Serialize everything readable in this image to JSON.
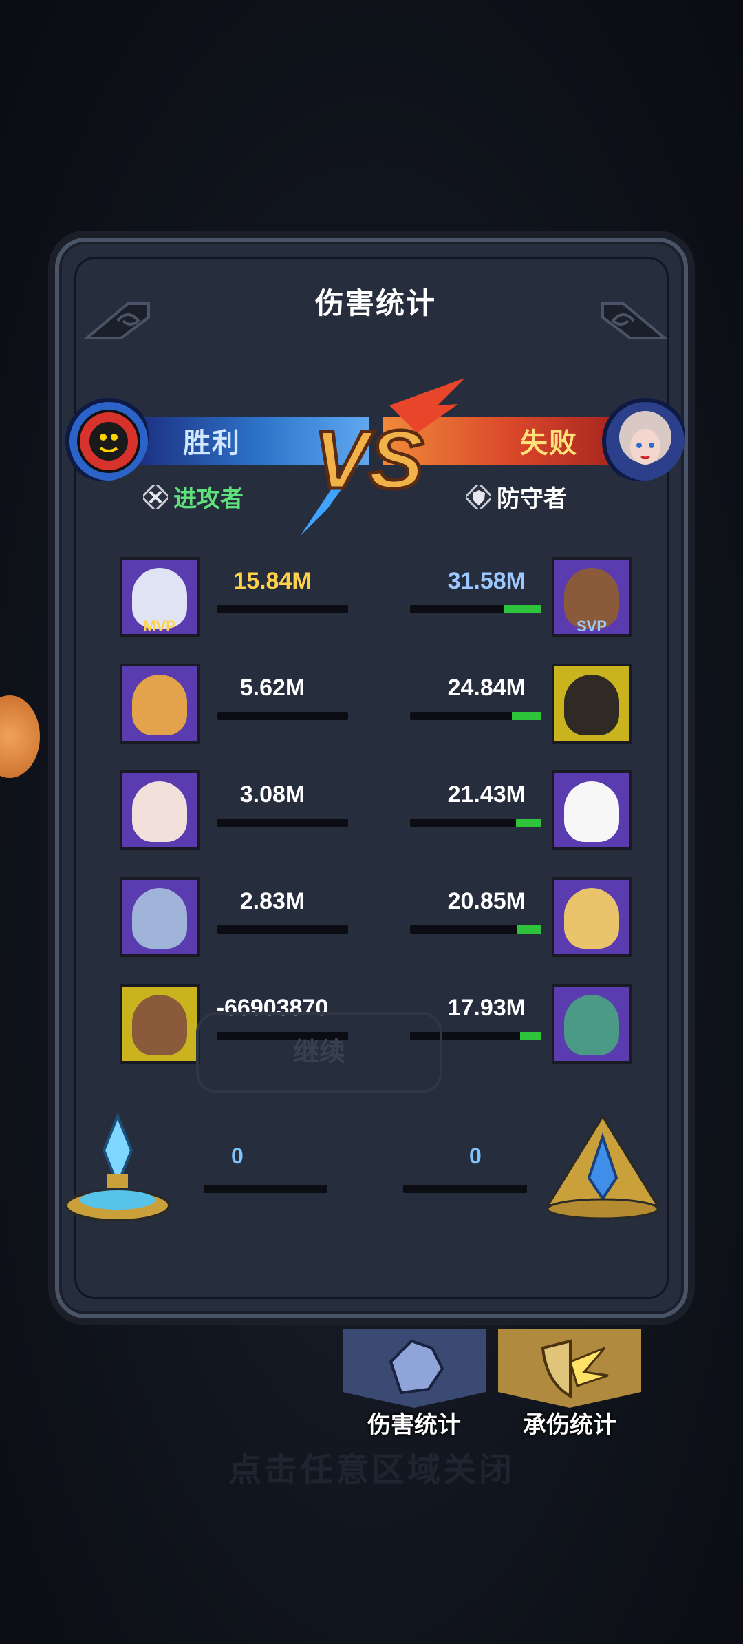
{
  "panel": {
    "title": "伤害统计"
  },
  "attacker": {
    "result": "胜利",
    "role": "进攻者",
    "color": "#2d74c9"
  },
  "defender": {
    "result": "失败",
    "role": "防守者",
    "color": "#d9462a"
  },
  "vs_text": "VS",
  "rows": [
    {
      "left_badge": "MVP",
      "left_value": "15.84M",
      "left_fill": 0,
      "right_badge": "SVP",
      "right_value": "31.58M",
      "right_fill": 0.28
    },
    {
      "left_badge": "",
      "left_value": "5.62M",
      "left_fill": 0,
      "right_badge": "",
      "right_value": "24.84M",
      "right_fill": 0.22
    },
    {
      "left_badge": "",
      "left_value": "3.08M",
      "left_fill": 0,
      "right_badge": "",
      "right_value": "21.43M",
      "right_fill": 0.19
    },
    {
      "left_badge": "",
      "left_value": "2.83M",
      "left_fill": 0,
      "right_badge": "",
      "right_value": "20.85M",
      "right_fill": 0.18
    },
    {
      "left_badge": "",
      "left_value": "-66903870",
      "left_fill": 0,
      "right_badge": "",
      "right_value": "17.93M",
      "right_fill": 0.16
    }
  ],
  "crystal": {
    "left_value": "0",
    "right_value": "0"
  },
  "tabs": [
    {
      "label": "伤害统计",
      "color": "#3a4a72"
    },
    {
      "label": "承伤统计",
      "color": "#b08a3e"
    }
  ],
  "colors": {
    "bar_fill": "#2dc43c",
    "mvp": "#ffd24a",
    "svp": "#9cc8ff",
    "left_top_value": "#ffd24a",
    "right_top_value": "#9cc8ff"
  }
}
